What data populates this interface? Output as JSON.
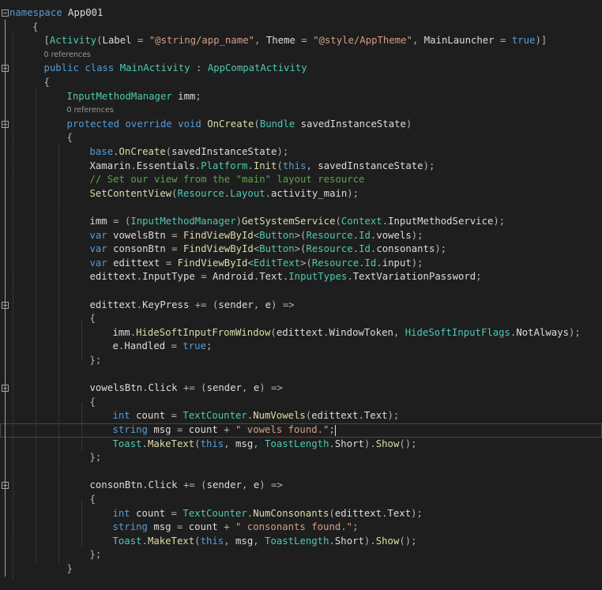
{
  "editor": {
    "lens_text": "0 references",
    "lines": [
      {
        "indent": 0,
        "lens": false,
        "fold": true,
        "tokens": [
          [
            "kw",
            "namespace"
          ],
          [
            "id",
            " App001"
          ]
        ]
      },
      {
        "indent": 1,
        "lens": false,
        "tokens": [
          [
            "pu",
            "{"
          ]
        ]
      },
      {
        "indent": 1.5,
        "lens": false,
        "tokens": [
          [
            "pu",
            "["
          ],
          [
            "ty",
            "Activity"
          ],
          [
            "pu",
            "("
          ],
          [
            "id",
            "Label "
          ],
          [
            "pu",
            "= "
          ],
          [
            "st",
            "\"@string/app_name\""
          ],
          [
            "pu",
            ", "
          ],
          [
            "id",
            "Theme "
          ],
          [
            "pu",
            "= "
          ],
          [
            "st",
            "\"@style/AppTheme\""
          ],
          [
            "pu",
            ", "
          ],
          [
            "id",
            "MainLauncher "
          ],
          [
            "pu",
            "= "
          ],
          [
            "kw",
            "true"
          ],
          [
            "pu",
            ")]"
          ]
        ]
      },
      {
        "indent": 1.5,
        "lens": true
      },
      {
        "indent": 1.5,
        "lens": false,
        "fold": true,
        "tokens": [
          [
            "kw",
            "public class "
          ],
          [
            "ty",
            "MainActivity"
          ],
          [
            "pu",
            " : "
          ],
          [
            "ty",
            "AppCompatActivity"
          ]
        ]
      },
      {
        "indent": 1.5,
        "lens": false,
        "tokens": [
          [
            "pu",
            "{"
          ]
        ]
      },
      {
        "indent": 2.5,
        "lens": false,
        "tokens": [
          [
            "ty",
            "InputMethodManager"
          ],
          [
            "id",
            " imm"
          ],
          [
            "pu",
            ";"
          ]
        ]
      },
      {
        "indent": 2.5,
        "lens": true
      },
      {
        "indent": 2.5,
        "lens": false,
        "fold": true,
        "tokens": [
          [
            "kw",
            "protected override void "
          ],
          [
            "fn",
            "OnCreate"
          ],
          [
            "pu",
            "("
          ],
          [
            "ty",
            "Bundle"
          ],
          [
            "id",
            " savedInstanceState"
          ],
          [
            "pu",
            ")"
          ]
        ]
      },
      {
        "indent": 2.5,
        "lens": false,
        "tokens": [
          [
            "pu",
            "{"
          ]
        ]
      },
      {
        "indent": 3.5,
        "lens": false,
        "tokens": [
          [
            "kw",
            "base"
          ],
          [
            "pu",
            "."
          ],
          [
            "fn",
            "OnCreate"
          ],
          [
            "pu",
            "("
          ],
          [
            "id",
            "savedInstanceState"
          ],
          [
            "pu",
            ");"
          ]
        ]
      },
      {
        "indent": 3.5,
        "lens": false,
        "tokens": [
          [
            "id",
            "Xamarin"
          ],
          [
            "pu",
            "."
          ],
          [
            "id",
            "Essentials"
          ],
          [
            "pu",
            "."
          ],
          [
            "ty",
            "Platform"
          ],
          [
            "pu",
            "."
          ],
          [
            "fn",
            "Init"
          ],
          [
            "pu",
            "("
          ],
          [
            "kw",
            "this"
          ],
          [
            "pu",
            ", "
          ],
          [
            "id",
            "savedInstanceState"
          ],
          [
            "pu",
            ");"
          ]
        ]
      },
      {
        "indent": 3.5,
        "lens": false,
        "tokens": [
          [
            "cm",
            "// Set our view from the \"main\" layout resource"
          ]
        ]
      },
      {
        "indent": 3.5,
        "lens": false,
        "tokens": [
          [
            "fn",
            "SetContentView"
          ],
          [
            "pu",
            "("
          ],
          [
            "ty",
            "Resource"
          ],
          [
            "pu",
            "."
          ],
          [
            "ty",
            "Layout"
          ],
          [
            "pu",
            "."
          ],
          [
            "id",
            "activity_main"
          ],
          [
            "pu",
            ");"
          ]
        ]
      },
      {
        "indent": 3.5,
        "lens": false,
        "tokens": []
      },
      {
        "indent": 3.5,
        "lens": false,
        "tokens": [
          [
            "id",
            "imm "
          ],
          [
            "pu",
            "= ("
          ],
          [
            "ty",
            "InputMethodManager"
          ],
          [
            "pu",
            ")"
          ],
          [
            "fn",
            "GetSystemService"
          ],
          [
            "pu",
            "("
          ],
          [
            "ty",
            "Context"
          ],
          [
            "pu",
            "."
          ],
          [
            "id",
            "InputMethodService"
          ],
          [
            "pu",
            ");"
          ]
        ]
      },
      {
        "indent": 3.5,
        "lens": false,
        "tokens": [
          [
            "kw",
            "var "
          ],
          [
            "id",
            "vowelsBtn "
          ],
          [
            "pu",
            "= "
          ],
          [
            "fn",
            "FindViewById"
          ],
          [
            "pu",
            "<"
          ],
          [
            "ty",
            "Button"
          ],
          [
            "pu",
            ">("
          ],
          [
            "ty",
            "Resource"
          ],
          [
            "pu",
            "."
          ],
          [
            "ty",
            "Id"
          ],
          [
            "pu",
            "."
          ],
          [
            "id",
            "vowels"
          ],
          [
            "pu",
            ");"
          ]
        ]
      },
      {
        "indent": 3.5,
        "lens": false,
        "tokens": [
          [
            "kw",
            "var "
          ],
          [
            "id",
            "consonBtn "
          ],
          [
            "pu",
            "= "
          ],
          [
            "fn",
            "FindViewById"
          ],
          [
            "pu",
            "<"
          ],
          [
            "ty",
            "Button"
          ],
          [
            "pu",
            ">("
          ],
          [
            "ty",
            "Resource"
          ],
          [
            "pu",
            "."
          ],
          [
            "ty",
            "Id"
          ],
          [
            "pu",
            "."
          ],
          [
            "id",
            "consonants"
          ],
          [
            "pu",
            ");"
          ]
        ]
      },
      {
        "indent": 3.5,
        "lens": false,
        "tokens": [
          [
            "kw",
            "var "
          ],
          [
            "id",
            "edittext "
          ],
          [
            "pu",
            "= "
          ],
          [
            "fn",
            "FindViewById"
          ],
          [
            "pu",
            "<"
          ],
          [
            "ty",
            "EditText"
          ],
          [
            "pu",
            ">("
          ],
          [
            "ty",
            "Resource"
          ],
          [
            "pu",
            "."
          ],
          [
            "ty",
            "Id"
          ],
          [
            "pu",
            "."
          ],
          [
            "id",
            "input"
          ],
          [
            "pu",
            ");"
          ]
        ]
      },
      {
        "indent": 3.5,
        "lens": false,
        "tokens": [
          [
            "id",
            "edittext"
          ],
          [
            "pu",
            "."
          ],
          [
            "id",
            "InputType "
          ],
          [
            "pu",
            "= "
          ],
          [
            "id",
            "Android"
          ],
          [
            "pu",
            "."
          ],
          [
            "id",
            "Text"
          ],
          [
            "pu",
            "."
          ],
          [
            "ty",
            "InputTypes"
          ],
          [
            "pu",
            "."
          ],
          [
            "id",
            "TextVariationPassword"
          ],
          [
            "pu",
            ";"
          ]
        ]
      },
      {
        "indent": 3.5,
        "lens": false,
        "tokens": []
      },
      {
        "indent": 3.5,
        "lens": false,
        "fold": true,
        "tokens": [
          [
            "id",
            "edittext"
          ],
          [
            "pu",
            "."
          ],
          [
            "id",
            "KeyPress "
          ],
          [
            "pu",
            "+= ("
          ],
          [
            "id",
            "sender"
          ],
          [
            "pu",
            ", "
          ],
          [
            "id",
            "e"
          ],
          [
            "pu",
            ") =>"
          ]
        ]
      },
      {
        "indent": 3.5,
        "lens": false,
        "tokens": [
          [
            "pu",
            "{"
          ]
        ]
      },
      {
        "indent": 4.5,
        "lens": false,
        "tokens": [
          [
            "id",
            "imm"
          ],
          [
            "pu",
            "."
          ],
          [
            "fn",
            "HideSoftInputFromWindow"
          ],
          [
            "pu",
            "("
          ],
          [
            "id",
            "edittext"
          ],
          [
            "pu",
            "."
          ],
          [
            "id",
            "WindowToken"
          ],
          [
            "pu",
            ", "
          ],
          [
            "ty",
            "HideSoftInputFlags"
          ],
          [
            "pu",
            "."
          ],
          [
            "id",
            "NotAlways"
          ],
          [
            "pu",
            ");"
          ]
        ]
      },
      {
        "indent": 4.5,
        "lens": false,
        "tokens": [
          [
            "id",
            "e"
          ],
          [
            "pu",
            "."
          ],
          [
            "id",
            "Handled "
          ],
          [
            "pu",
            "= "
          ],
          [
            "kw",
            "true"
          ],
          [
            "pu",
            ";"
          ]
        ]
      },
      {
        "indent": 3.5,
        "lens": false,
        "tokens": [
          [
            "pu",
            "};"
          ]
        ]
      },
      {
        "indent": 3.5,
        "lens": false,
        "tokens": []
      },
      {
        "indent": 3.5,
        "lens": false,
        "fold": true,
        "tokens": [
          [
            "id",
            "vowelsBtn"
          ],
          [
            "pu",
            "."
          ],
          [
            "id",
            "Click "
          ],
          [
            "pu",
            "+= ("
          ],
          [
            "id",
            "sender"
          ],
          [
            "pu",
            ", "
          ],
          [
            "id",
            "e"
          ],
          [
            "pu",
            ") =>"
          ]
        ]
      },
      {
        "indent": 3.5,
        "lens": false,
        "tokens": [
          [
            "pu",
            "{"
          ]
        ]
      },
      {
        "indent": 4.5,
        "lens": false,
        "tokens": [
          [
            "kw",
            "int "
          ],
          [
            "id",
            "count "
          ],
          [
            "pu",
            "= "
          ],
          [
            "ty",
            "TextCounter"
          ],
          [
            "pu",
            "."
          ],
          [
            "fn",
            "NumVowels"
          ],
          [
            "pu",
            "("
          ],
          [
            "id",
            "edittext"
          ],
          [
            "pu",
            "."
          ],
          [
            "id",
            "Text"
          ],
          [
            "pu",
            ");"
          ]
        ]
      },
      {
        "indent": 4.5,
        "lens": false,
        "current": true,
        "tokens": [
          [
            "kw",
            "string "
          ],
          [
            "id",
            "msg "
          ],
          [
            "pu",
            "= "
          ],
          [
            "id",
            "count "
          ],
          [
            "pu",
            "+ "
          ],
          [
            "st",
            "\" vowels found.\""
          ],
          [
            "pu",
            ";"
          ]
        ]
      },
      {
        "indent": 4.5,
        "lens": false,
        "tokens": [
          [
            "ty",
            "Toast"
          ],
          [
            "pu",
            "."
          ],
          [
            "fn",
            "MakeText"
          ],
          [
            "pu",
            "("
          ],
          [
            "kw",
            "this"
          ],
          [
            "pu",
            ", "
          ],
          [
            "id",
            "msg"
          ],
          [
            "pu",
            ", "
          ],
          [
            "ty",
            "ToastLength"
          ],
          [
            "pu",
            "."
          ],
          [
            "id",
            "Short"
          ],
          [
            "pu",
            ")."
          ],
          [
            "fn",
            "Show"
          ],
          [
            "pu",
            "();"
          ]
        ]
      },
      {
        "indent": 3.5,
        "lens": false,
        "tokens": [
          [
            "pu",
            "};"
          ]
        ]
      },
      {
        "indent": 3.5,
        "lens": false,
        "tokens": []
      },
      {
        "indent": 3.5,
        "lens": false,
        "fold": true,
        "tokens": [
          [
            "id",
            "consonBtn"
          ],
          [
            "pu",
            "."
          ],
          [
            "id",
            "Click "
          ],
          [
            "pu",
            "+= ("
          ],
          [
            "id",
            "sender"
          ],
          [
            "pu",
            ", "
          ],
          [
            "id",
            "e"
          ],
          [
            "pu",
            ") =>"
          ]
        ]
      },
      {
        "indent": 3.5,
        "lens": false,
        "tokens": [
          [
            "pu",
            "{"
          ]
        ]
      },
      {
        "indent": 4.5,
        "lens": false,
        "tokens": [
          [
            "kw",
            "int "
          ],
          [
            "id",
            "count "
          ],
          [
            "pu",
            "= "
          ],
          [
            "ty",
            "TextCounter"
          ],
          [
            "pu",
            "."
          ],
          [
            "fn",
            "NumConsonants"
          ],
          [
            "pu",
            "("
          ],
          [
            "id",
            "edittext"
          ],
          [
            "pu",
            "."
          ],
          [
            "id",
            "Text"
          ],
          [
            "pu",
            ");"
          ]
        ]
      },
      {
        "indent": 4.5,
        "lens": false,
        "tokens": [
          [
            "kw",
            "string "
          ],
          [
            "id",
            "msg "
          ],
          [
            "pu",
            "= "
          ],
          [
            "id",
            "count "
          ],
          [
            "pu",
            "+ "
          ],
          [
            "st",
            "\" consonants found.\""
          ],
          [
            "pu",
            ";"
          ]
        ]
      },
      {
        "indent": 4.5,
        "lens": false,
        "tokens": [
          [
            "ty",
            "Toast"
          ],
          [
            "pu",
            "."
          ],
          [
            "fn",
            "MakeText"
          ],
          [
            "pu",
            "("
          ],
          [
            "kw",
            "this"
          ],
          [
            "pu",
            ", "
          ],
          [
            "id",
            "msg"
          ],
          [
            "pu",
            ", "
          ],
          [
            "ty",
            "ToastLength"
          ],
          [
            "pu",
            "."
          ],
          [
            "id",
            "Short"
          ],
          [
            "pu",
            ")."
          ],
          [
            "fn",
            "Show"
          ],
          [
            "pu",
            "();"
          ]
        ]
      },
      {
        "indent": 3.5,
        "lens": false,
        "tokens": [
          [
            "pu",
            "};"
          ]
        ]
      },
      {
        "indent": 2.5,
        "lens": false,
        "tokens": [
          [
            "pu",
            "}"
          ]
        ]
      },
      {
        "indent": 1.5,
        "lens": false,
        "tokens": []
      }
    ]
  },
  "colors": {
    "background": "#1e1e1e",
    "keyword": "#569cd6",
    "type": "#4ec9b0",
    "method": "#dcdcaa",
    "string": "#d69d85",
    "comment": "#57a64a",
    "text": "#dcdcdc"
  }
}
